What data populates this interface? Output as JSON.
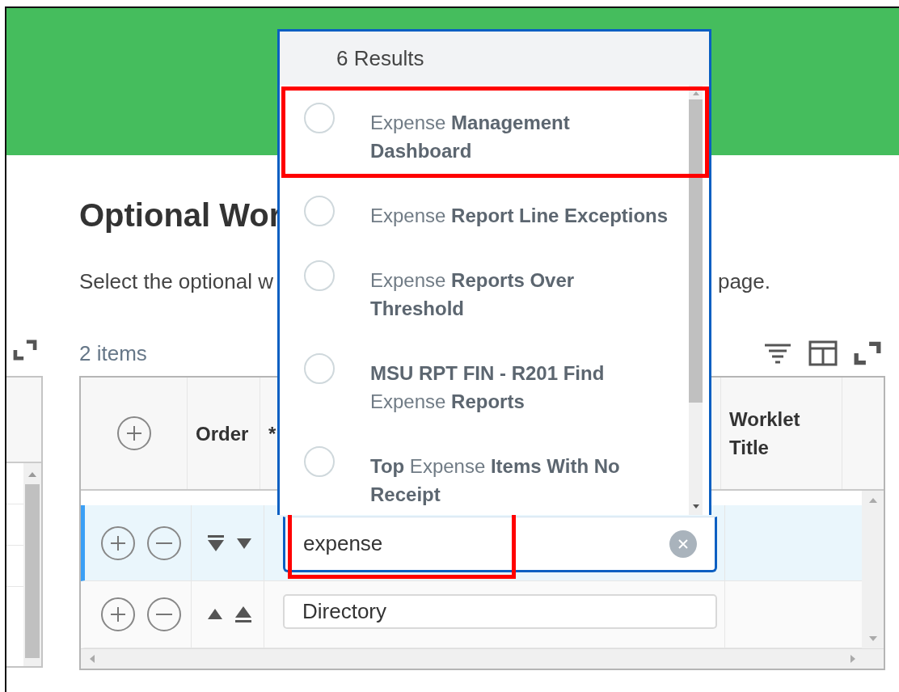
{
  "page": {
    "title": "Optional Wor",
    "description_start": "Select the optional w",
    "description_end": "page."
  },
  "table_toolbar": {
    "count": "2 items"
  },
  "dropdown": {
    "count": "6 Results",
    "results": [
      {
        "label": "Expense **Management Dashboard**",
        "selected": false,
        "highlighted": true
      },
      {
        "label": "Expense **Report Line Exceptions**",
        "selected": false,
        "highlighted": false
      },
      {
        "label": "Expense **Reports Over Threshold**",
        "selected": false,
        "highlighted": false
      },
      {
        "label": "**MSU RPT FIN - R201 Find** Expense **Reports**",
        "selected": false,
        "highlighted": false
      },
      {
        "label": "**Top** Expense **Items With No Receipt**",
        "selected": false,
        "highlighted": false
      }
    ]
  },
  "table": {
    "columns": [
      {
        "kind": "add"
      },
      {
        "kind": "text",
        "label": "Order"
      },
      {
        "kind": "text",
        "label": "*"
      },
      {
        "kind": "text",
        "label": "Worklet Title"
      },
      {
        "kind": "blank"
      }
    ],
    "rows": [
      {
        "selected": true,
        "moves": [
          {
            "kind": "bottom"
          },
          {
            "kind": "down"
          }
        ],
        "field": {
          "value": "expense",
          "open": true,
          "highlighted": true
        }
      },
      {
        "selected": false,
        "moves": [
          {
            "kind": "up"
          },
          {
            "kind": "top"
          }
        ],
        "field": {
          "value": "Directory",
          "open": false,
          "highlighted": false
        }
      }
    ]
  }
}
